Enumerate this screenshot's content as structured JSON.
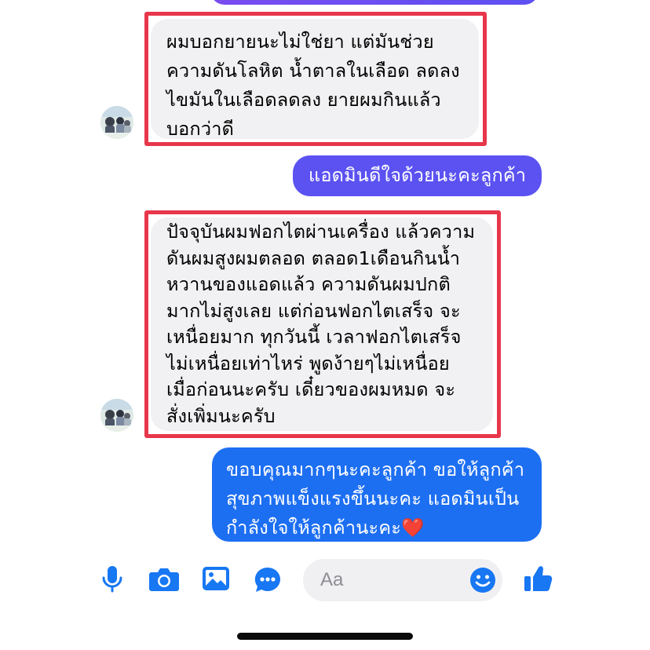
{
  "messages": [
    {
      "direction": "incoming",
      "text": "ผมบอกยายนะไม่ใช่ยา  แต่มันช่วย\nความดันโลหิต น้ำตาลในเลือด ลดลง\nไขมันในเลือดลดลง ยายผมกินแล้ว\nบอกว่าดี",
      "highlighted": true
    },
    {
      "direction": "outgoing",
      "text": "แอดมินดีใจด้วยนะคะลูกค้า"
    },
    {
      "direction": "incoming",
      "text": "ปัจจุบันผมฟอกไตผ่านเครื่อง แล้วความ\nดันผมสูงผมตลอด ตลอด1เดือนกินน้ำ\nหวานของแอดแล้ว ความดันผมปกติ\nมากไม่สูงเลย แต่ก่อนฟอกไตเสร็จ จะ\nเหนื่อยมาก ทุกวันนี้ เวลาฟอกไตเสร็จ\nไม่เหนื่อยเท่าไหร่ พูดง้ายๆไม่เหนื่อย\nเมื่อก่อนนะครับ เดี๋ยวของผมหมด  จะ\nสั่งเพิ่มนะครับ",
      "highlighted": true
    },
    {
      "direction": "outgoing",
      "text": "ขอบคุณมากๆนะคะลูกค้า ขอให้ลูกค้า\nสุขภาพแข็งแรงขึ้นนะคะ แอดมินเป็น\nกำลังใจให้ลูกค้านะคะ❤️"
    }
  ],
  "composer": {
    "placeholder": "Aa"
  },
  "toolbar": {
    "icons": [
      "microphone-icon",
      "camera-icon",
      "gallery-icon",
      "chat-apps-icon",
      "emoji-icon",
      "thumbs-up-icon"
    ]
  },
  "colors": {
    "accent": "#1877f2",
    "outgoing_purple": "#5b52f1",
    "outgoing_blue": "#1d6ff2",
    "incoming_bg": "#f1f1f3",
    "highlight": "#e8364b"
  }
}
